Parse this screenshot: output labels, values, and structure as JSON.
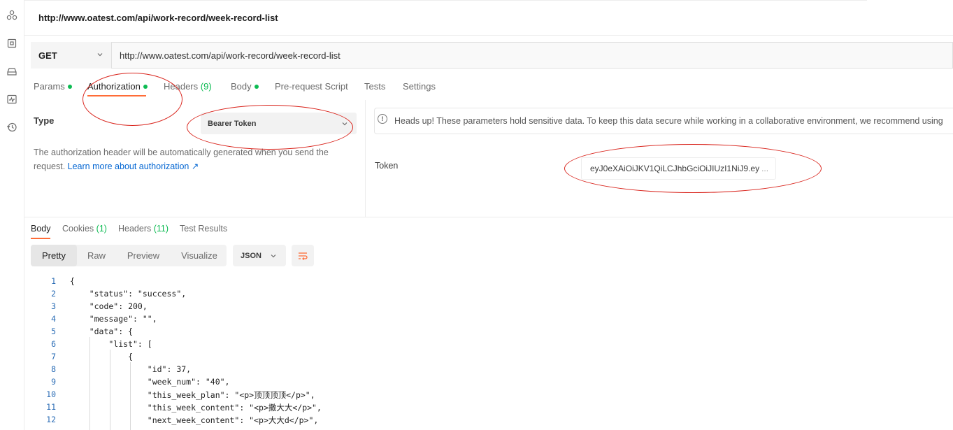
{
  "rail": {
    "icons": [
      "apis-icon",
      "environment-icon",
      "mock-server-icon",
      "monitor-icon",
      "history-icon"
    ]
  },
  "request": {
    "title": "http://www.oatest.com/api/work-record/week-record-list",
    "method": "GET",
    "url": "http://www.oatest.com/api/work-record/week-record-list"
  },
  "request_tabs": {
    "params": "Params",
    "authorization": "Authorization",
    "headers": "Headers",
    "headers_count": "(9)",
    "body": "Body",
    "pre_request": "Pre-request Script",
    "tests": "Tests",
    "settings": "Settings",
    "active": "Authorization"
  },
  "auth": {
    "type_label": "Type",
    "type_value": "Bearer Token",
    "description": "The authorization header will be automatically generated when you send the request.",
    "learn_more": "Learn more about authorization ↗",
    "notice": "Heads up! These parameters hold sensitive data. To keep this data secure while working in a collaborative environment, we recommend using",
    "token_label": "Token",
    "token_value": "eyJ0eXAiOiJKV1QiLCJhbGciOiJIUzI1NiJ9.ey",
    "token_ellipsis": "..."
  },
  "response_tabs": {
    "body": "Body",
    "cookies": "Cookies",
    "cookies_count": "(1)",
    "headers": "Headers",
    "headers_count": "(11)",
    "test_results": "Test Results"
  },
  "view": {
    "modes": [
      "Pretty",
      "Raw",
      "Preview",
      "Visualize"
    ],
    "active": "Pretty",
    "format": "JSON"
  },
  "code_lines": [
    {
      "n": "1",
      "text": "{"
    },
    {
      "n": "2",
      "text": "    \"status\": \"success\","
    },
    {
      "n": "3",
      "text": "    \"code\": 200,"
    },
    {
      "n": "4",
      "text": "    \"message\": \"\","
    },
    {
      "n": "5",
      "text": "    \"data\": {"
    },
    {
      "n": "6",
      "text": "        \"list\": ["
    },
    {
      "n": "7",
      "text": "            {"
    },
    {
      "n": "8",
      "text": "                \"id\": 37,"
    },
    {
      "n": "9",
      "text": "                \"week_num\": \"40\","
    },
    {
      "n": "10",
      "text": "                \"this_week_plan\": \"<p>顶顶顶顶</p>\","
    },
    {
      "n": "11",
      "text": "                \"this_week_content\": \"<p>撒大大</p>\","
    },
    {
      "n": "12",
      "text": "                \"next_week_content\": \"<p>大大d</p>\","
    }
  ],
  "colors": {
    "accent": "#ff6c37",
    "green": "#0cbb52",
    "annotation_red": "#d9241c",
    "link": "#0265d2"
  }
}
